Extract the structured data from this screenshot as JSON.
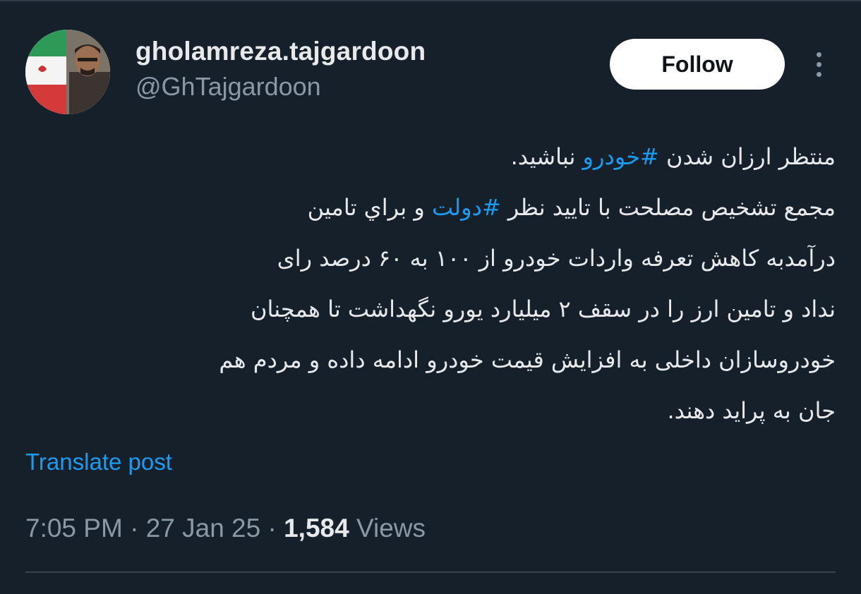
{
  "author": {
    "display_name": "gholamreza.tajgardoon",
    "handle": "@GhTajgardoon"
  },
  "actions": {
    "follow_label": "Follow",
    "more_icon": "more-vertical-icon"
  },
  "tweet": {
    "lines": [
      [
        {
          "text": "منتظر ارزان شدن ",
          "hashtag": false
        },
        {
          "text": "#خودرو",
          "hashtag": true
        },
        {
          "text": " نباشید.",
          "hashtag": false
        }
      ],
      [
        {
          "text": "مجمع تشخیص مصلحت  با تایید  نظر ",
          "hashtag": false
        },
        {
          "text": "#دولت",
          "hashtag": true
        },
        {
          "text": " و براي تامین",
          "hashtag": false
        }
      ],
      [
        {
          "text": "درآمدبه کاهش تعرفه واردات خودرو از ۱۰۰  به ۶۰ درصد رای",
          "hashtag": false
        }
      ],
      [
        {
          "text": "نداد و تامین ارز را در سقف ۲ میلیارد یورو نگهداشت تا همچنان",
          "hashtag": false
        }
      ],
      [
        {
          "text": "خودروسازان داخلی به افزایش قیمت خودرو ادامه داده و مردم هم",
          "hashtag": false
        }
      ],
      [
        {
          "text": "جان به پراید دهند.",
          "hashtag": false
        }
      ]
    ]
  },
  "translate_label": "Translate post",
  "meta": {
    "time": "7:05 PM",
    "separator": " · ",
    "date": "27 Jan 25",
    "views_count": "1,584",
    "views_label": " Views"
  },
  "colors": {
    "background": "#15202b",
    "accent": "#1d9bf0",
    "text_primary": "#e7e9ea",
    "text_secondary": "#8b98a5"
  }
}
